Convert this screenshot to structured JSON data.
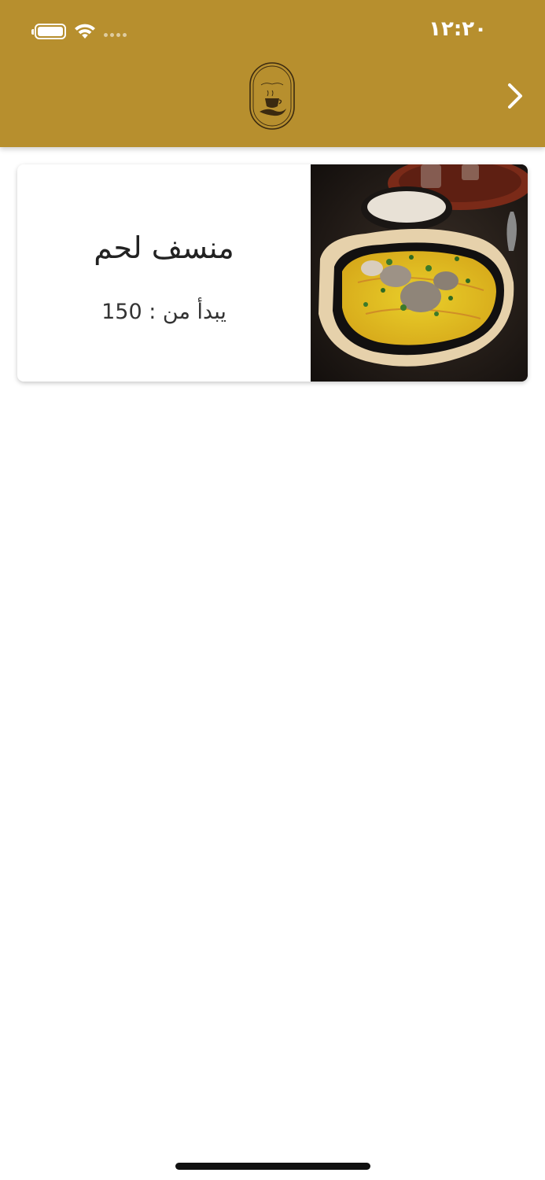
{
  "status_bar": {
    "time": "١٢:٢٠",
    "battery_icon": "battery-icon",
    "wifi_icon": "wifi-icon",
    "signal_icon": "cellular-signal-icon"
  },
  "header": {
    "logo_icon": "coffee-cup-logo-icon",
    "back_icon": "chevron-right-icon",
    "background_color": "#b78f2e"
  },
  "menu_items": [
    {
      "title": "منسف لحم",
      "price_text": "يبدأ من : 150",
      "image_icon": "mansaf-dish-image"
    }
  ],
  "colors": {
    "accent": "#b78f2e",
    "card_background": "#ffffff",
    "title_text": "#222222"
  }
}
